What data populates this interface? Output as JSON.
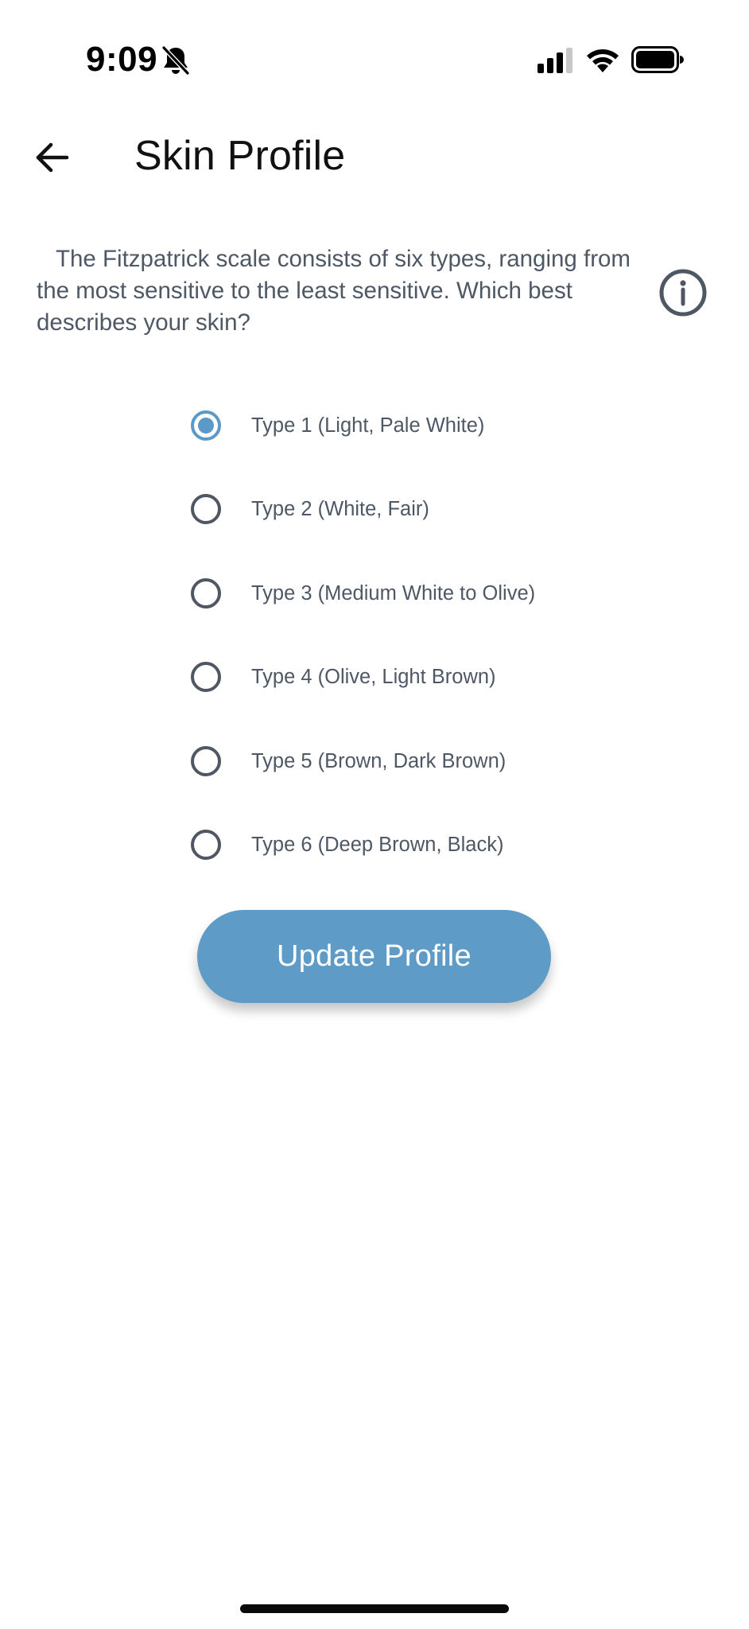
{
  "status_bar": {
    "time": "9:09",
    "icons": [
      "bell-slash-icon",
      "cellular-signal-icon",
      "wifi-icon",
      "battery-icon"
    ]
  },
  "header": {
    "back_icon": "arrow-left-icon",
    "title": "Skin Profile"
  },
  "description": {
    "text": "The Fitzpatrick scale consists of six types, ranging from the most sensitive to the least sensitive. Which best describes your skin?",
    "info_icon": "info-circle-icon"
  },
  "options": [
    {
      "label": "Type 1 (Light, Pale White)",
      "selected": true
    },
    {
      "label": "Type 2 (White, Fair)",
      "selected": false
    },
    {
      "label": "Type 3 (Medium White to Olive)",
      "selected": false
    },
    {
      "label": "Type 4 (Olive, Light Brown)",
      "selected": false
    },
    {
      "label": "Type 5 (Brown, Dark Brown)",
      "selected": false
    },
    {
      "label": "Type 6 (Deep Brown, Black)",
      "selected": false
    }
  ],
  "update_button": {
    "label": "Update Profile"
  },
  "colors": {
    "accent": "#5b9ac8",
    "button": "#5e9cc7",
    "text_muted": "#4e5864"
  }
}
